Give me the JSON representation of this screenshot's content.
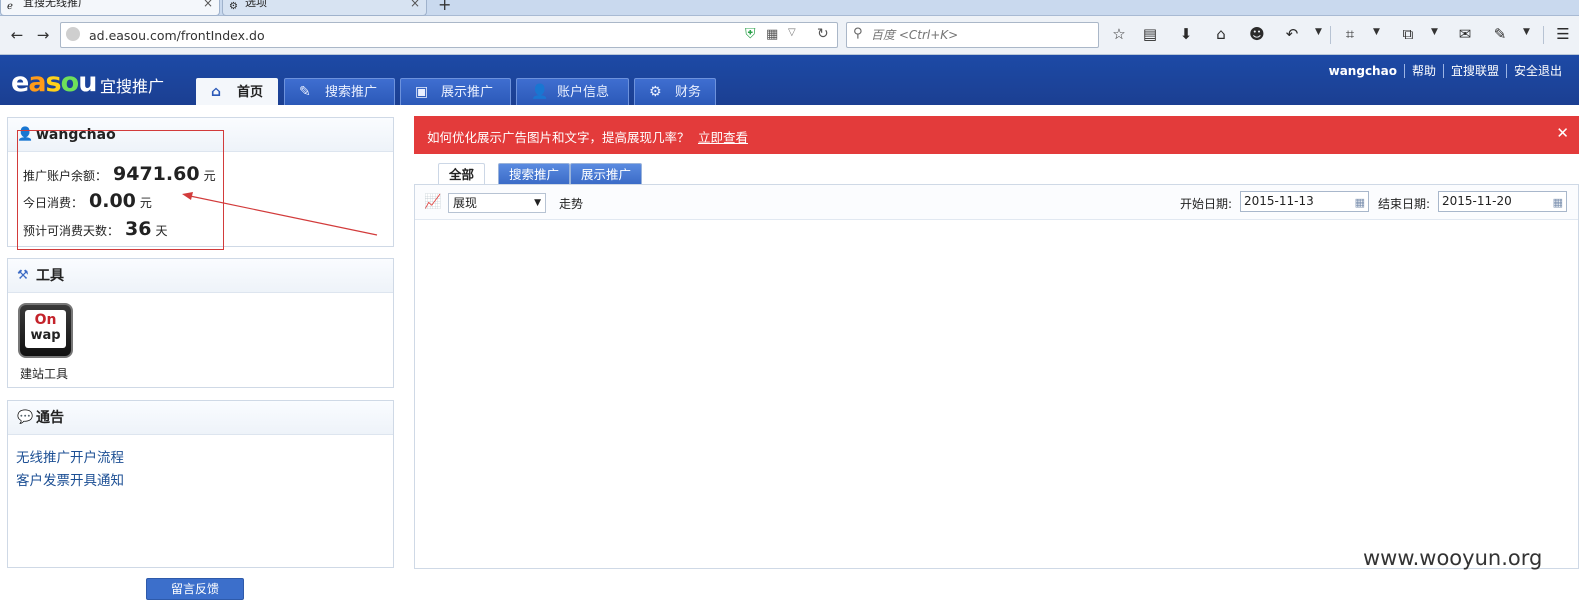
{
  "browser": {
    "tabs": [
      {
        "title": "宜搜无线推广",
        "active": true
      },
      {
        "title": "选项",
        "active": false
      }
    ],
    "url": "ad.easou.com/frontIndex.do",
    "search_placeholder": "百度 <Ctrl+K>"
  },
  "header": {
    "logo_text": "easou",
    "brand": "宜搜推广",
    "tabs": [
      {
        "label": "首页",
        "icon": "home-icon"
      },
      {
        "label": "搜索推广",
        "icon": "edit-icon"
      },
      {
        "label": "展示推广",
        "icon": "image-icon"
      },
      {
        "label": "账户信息",
        "icon": "user-icon"
      },
      {
        "label": "财务",
        "icon": "finance-icon"
      }
    ],
    "user": "wangchao",
    "links": [
      "帮助",
      "宜搜联盟",
      "安全退出"
    ]
  },
  "account": {
    "username": "wangchao",
    "balance_label": "推广账户余额：",
    "balance_value": "9471.60",
    "balance_unit": "元",
    "today_label": "今日消费：",
    "today_value": "0.00",
    "today_unit": "元",
    "days_label": "预计可消费天数：",
    "days_value": "36",
    "days_unit": "天"
  },
  "tools": {
    "title": "工具",
    "items": [
      {
        "label": "建站工具",
        "logo_top": "On",
        "logo_bottom": "wap"
      }
    ]
  },
  "notices": {
    "title": "通告",
    "items": [
      "无线推广开户流程",
      "客户发票开具通知"
    ]
  },
  "feedback_button": "留言反馈",
  "alert": {
    "text": "如何优化展示广告图片和文字，提高展现几率？",
    "link": "立即查看"
  },
  "subtabs": [
    "全部",
    "搜索推广",
    "展示推广"
  ],
  "filters": {
    "metric": "展现",
    "trend_label": "走势",
    "start_label": "开始日期:",
    "start_date": "2015-11-13",
    "end_label": "结束日期:",
    "end_date": "2015-11-20"
  },
  "watermark": "www.wooyun.org",
  "colors": {
    "header_blue": "#1b3f92",
    "alert_red": "#e33b3b",
    "link_blue": "#1c4f94",
    "annotation_red": "#d23b3b"
  }
}
